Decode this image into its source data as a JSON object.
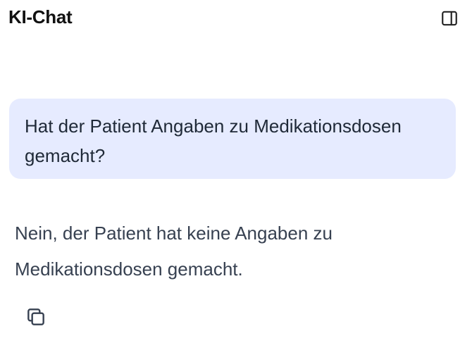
{
  "header": {
    "title": "KI-Chat",
    "toggle_icon": "sidebar-panel-icon"
  },
  "conversation": {
    "user_message": "Hat der Patient Angaben zu Medikationsdosen gemacht?",
    "assistant_message": "Nein, der Patient hat keine Angaben zu Medikationsdosen gemacht.",
    "copy_icon": "copy-icon"
  },
  "colors": {
    "user_bubble_bg": "#e6ebff",
    "text": "#1f2937",
    "icon": "#374151"
  }
}
